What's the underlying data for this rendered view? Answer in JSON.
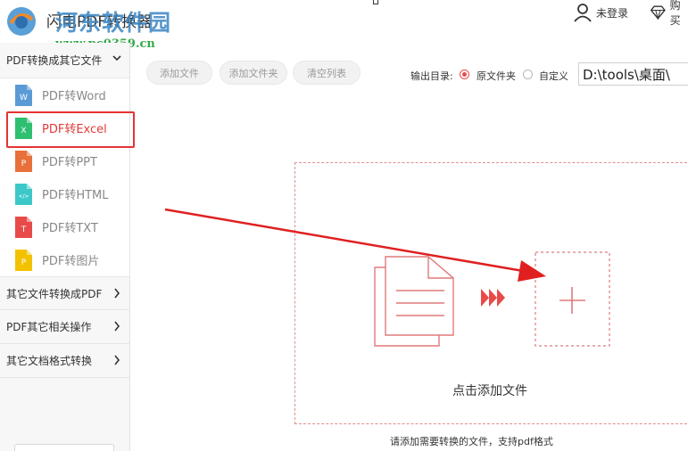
{
  "app": {
    "title": "闪电PDF转换器",
    "watermark_title": "河东软件园",
    "watermark_url": "www.pc0359.cn"
  },
  "header": {
    "login_label": "未登录",
    "buy_label": "购买"
  },
  "sidebar": {
    "group1": {
      "label": "PDF转换成其它文件",
      "items": [
        {
          "label": "PDF转Word",
          "icon": "word-file-icon",
          "letter": "W",
          "color": "#5b9bd5"
        },
        {
          "label": "PDF转Excel",
          "icon": "excel-file-icon",
          "letter": "X",
          "color": "#2fbf71"
        },
        {
          "label": "PDF转PPT",
          "icon": "ppt-file-icon",
          "letter": "P",
          "color": "#e8703a"
        },
        {
          "label": "PDF转HTML",
          "icon": "html-file-icon",
          "letter": "</>",
          "color": "#3cc8c8"
        },
        {
          "label": "PDF转TXT",
          "icon": "txt-file-icon",
          "letter": "T",
          "color": "#e84a4a"
        },
        {
          "label": "PDF转图片",
          "icon": "image-file-icon",
          "letter": "P",
          "color": "#f2c200"
        }
      ]
    },
    "group2": {
      "label": "其它文件转换成PDF"
    },
    "group3": {
      "label": "PDF其它相关操作"
    },
    "group4": {
      "label": "其它文档格式转换"
    }
  },
  "toolbar": {
    "add_file": "添加文件",
    "add_folder": "添加文件夹",
    "clear_list": "清空列表",
    "output_label": "输出目录:",
    "radio_original": "原文件夹",
    "radio_custom": "自定义",
    "output_path": "D:\\tools\\桌面\\"
  },
  "dropzone": {
    "click_text": "点击添加文件",
    "hint_text": "请添加需要转换的文件，支持pdf格式"
  },
  "colors": {
    "accent_red": "#e84a4a",
    "highlight_border": "#e63333",
    "watermark_blue": "#3b86c4",
    "watermark_green": "#37a84a"
  }
}
